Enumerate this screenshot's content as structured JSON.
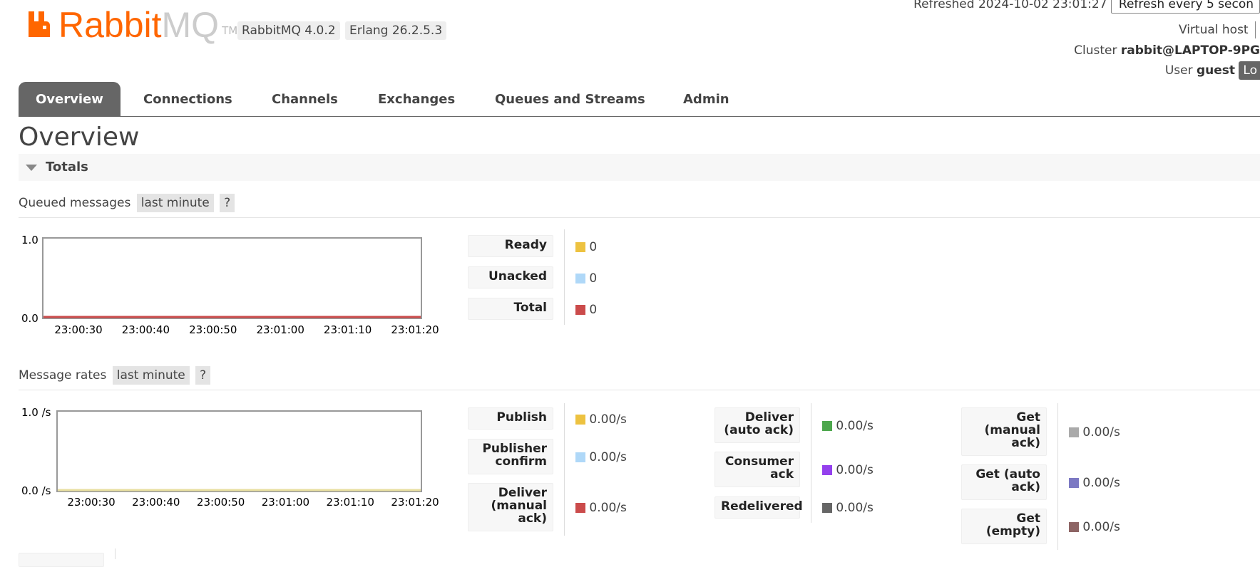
{
  "brand": {
    "name_part1": "Rabbit",
    "name_part2": "MQ",
    "tm": "TM"
  },
  "versions": {
    "rabbitmq": "RabbitMQ 4.0.2",
    "erlang": "Erlang 26.2.5.3"
  },
  "header": {
    "refreshed_label": "Refreshed 2024-10-02 23:01:27",
    "refresh_select_value": "Refresh every 5 secon",
    "virtual_host_label": "Virtual host",
    "cluster_label": "Cluster",
    "cluster_value": "rabbit@LAPTOP-9PG",
    "user_label": "User",
    "user_value": "guest",
    "logout_label": "Lo"
  },
  "tabs": [
    {
      "label": "Overview",
      "active": true
    },
    {
      "label": "Connections"
    },
    {
      "label": "Channels"
    },
    {
      "label": "Exchanges"
    },
    {
      "label": "Queues and Streams"
    },
    {
      "label": "Admin"
    }
  ],
  "page_title": "Overview",
  "totals": {
    "label": "Totals"
  },
  "queued": {
    "title": "Queued messages",
    "range": "last minute",
    "help": "?",
    "chart": {
      "ymax_label": "1.0",
      "ymin_label": "0.0",
      "x_ticks": [
        "23:00:30",
        "23:00:40",
        "23:00:50",
        "23:01:00",
        "23:01:10",
        "23:01:20"
      ]
    },
    "legend": [
      {
        "label": "Ready",
        "value": "0",
        "color": "#edc240"
      },
      {
        "label": "Unacked",
        "value": "0",
        "color": "#afd8f8"
      },
      {
        "label": "Total",
        "value": "0",
        "color": "#cb4b4b"
      }
    ]
  },
  "rates": {
    "title": "Message rates",
    "range": "last minute",
    "help": "?",
    "chart": {
      "ymax_label": "1.0 /s",
      "ymin_label": "0.0 /s",
      "x_ticks": [
        "23:00:30",
        "23:00:40",
        "23:00:50",
        "23:01:00",
        "23:01:10",
        "23:01:20"
      ]
    },
    "col1": [
      {
        "label": "Publish",
        "value": "0.00/s",
        "color": "#edc240"
      },
      {
        "label": "Publisher confirm",
        "value": "0.00/s",
        "color": "#afd8f8"
      },
      {
        "label": "Deliver (manual ack)",
        "value": "0.00/s",
        "color": "#cb4b4b"
      }
    ],
    "col2": [
      {
        "label": "Deliver (auto ack)",
        "value": "0.00/s",
        "color": "#4da74d"
      },
      {
        "label": "Consumer ack",
        "value": "0.00/s",
        "color": "#9440ed"
      },
      {
        "label": "Redelivered",
        "value": "0.00/s",
        "color": "#666666"
      }
    ],
    "col3": [
      {
        "label": "Get (manual ack)",
        "value": "0.00/s",
        "color": "#aaaaaa"
      },
      {
        "label": "Get (auto ack)",
        "value": "0.00/s",
        "color": "#7c79c3"
      },
      {
        "label": "Get (empty)",
        "value": "0.00/s",
        "color": "#8d6464"
      }
    ]
  }
}
